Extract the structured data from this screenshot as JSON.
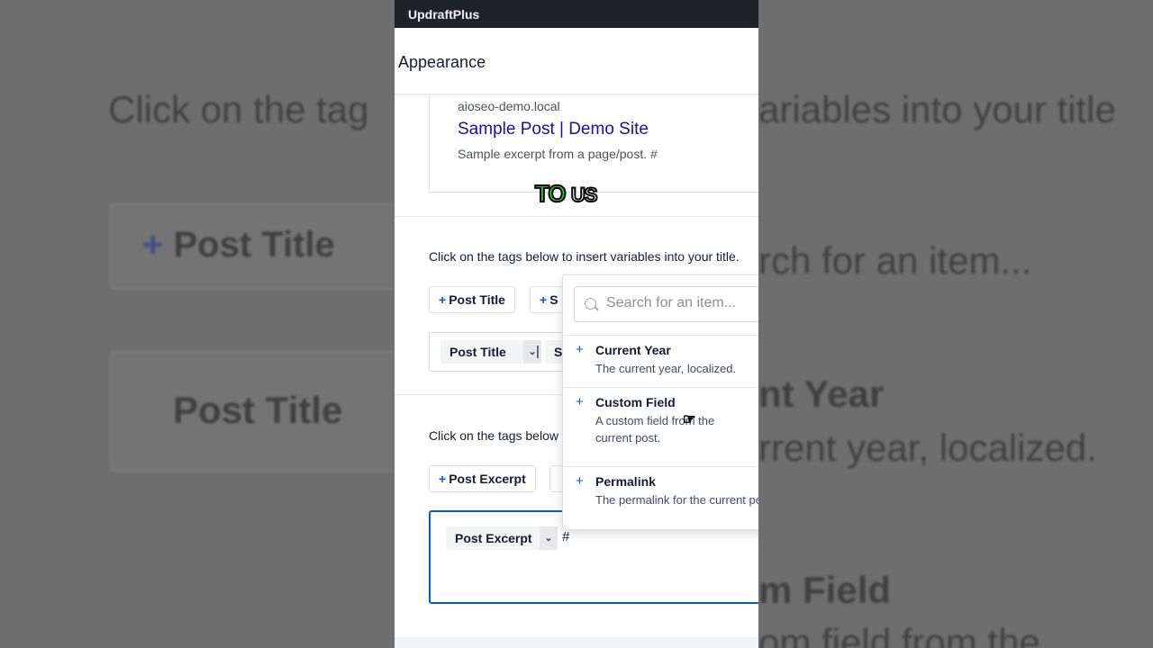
{
  "app": {
    "title": "UpdraftPlus"
  },
  "page": {
    "section_title": "Appearance"
  },
  "preview": {
    "domain": "aioseo-demo.local",
    "title": "Sample Post | Demo Site",
    "description": "Sample excerpt from a page/post. #"
  },
  "caption": {
    "word1": "TO",
    "word2": "US"
  },
  "title_section": {
    "instruction": "Click on the tags below to insert variables into your title.",
    "tag_buttons": [
      "Post Title",
      "S"
    ],
    "editor_chip": "Post Title",
    "editor_separator": "|",
    "editor_chip2": "S"
  },
  "desc_section": {
    "instruction": "Click on the tags below",
    "tag_buttons": [
      "Post Excerpt"
    ],
    "editor_chip": "Post Excerpt",
    "editor_text": "#"
  },
  "dropdown": {
    "search_placeholder": "Search for an item...",
    "items": [
      {
        "name": "Current Year",
        "desc": "The current year, localized."
      },
      {
        "name": "Custom Field",
        "desc": "A custom field from the current post."
      },
      {
        "name": "Permalink",
        "desc": "The permalink for the current post."
      }
    ]
  },
  "background": {
    "left_instruction": "Click on the tag",
    "right_instruction": "ariables into your title",
    "left_tag": "Post Title",
    "left_chip": "Post Title",
    "right_search": "rch for an item...",
    "right_item1": "nt Year",
    "right_item1_desc": "rrent year, localized.",
    "right_item2": "m Field",
    "right_item2_desc": "om field from the"
  },
  "colors": {
    "accent": "#005ae0",
    "caption_green": "#2bd43d",
    "topbar": "#1d2327",
    "link": "#1a0dab"
  }
}
